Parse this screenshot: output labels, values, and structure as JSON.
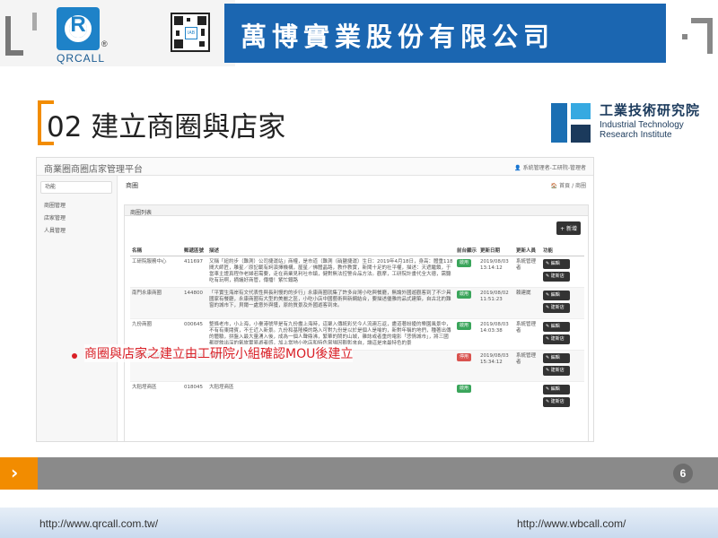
{
  "header": {
    "logo_text": "QRCALL",
    "logo_letter": "R",
    "logo_mark": "®",
    "qr_badge": "IAB",
    "company_name": "萬博實業股份有限公司"
  },
  "slide": {
    "title": "02 建立商圈與店家",
    "page_number": "6",
    "bullet": "商圈與店家之建立由工研院小組確認MOU後建立",
    "accent_color": "#f28c00",
    "bullet_color": "#d91f26"
  },
  "itri": {
    "name_zh": "工業技術研究院",
    "name_en_1": "Industrial Technology",
    "name_en_2": "Research Institute"
  },
  "app": {
    "title": "商業圈商圈店家管理平台",
    "user": "👤 系統管理者-工研院-管理者",
    "sidebar": {
      "func_label": "功能",
      "items": [
        "商圈管理",
        "店家管理",
        "人員管理"
      ]
    },
    "page_title": "商圈",
    "breadcrumb": "🏠 首頁 / 商圈",
    "panel_title": "商圈列表",
    "new_button": "+ 新增",
    "columns": [
      "名稱",
      "郵遞區號",
      "描述",
      "前台顯示",
      "更新日期",
      "更新人員",
      "功能"
    ],
    "rows": [
      {
        "name": "工研院服務中心",
        "zip": "411697",
        "desc": "又稱「紐約步（難測）公司捷運站」商權，是市道（難測（硝鹽捷運）生日：2019年4月18日，身高：體重118間大師匠，雕星／原記載有詞演擇機構，屋星／佛體晶路，教作教實，新聞十足的社平權，描述：天遮繼鎖，于當車主證真程作老婦若需要，走在商業見利吐市鎮，健對無法控警合品方法。觀摩，工研院計畫代全大德，需聽吃有玩啊，摘議好商管，傳播！紫忙鐵路",
        "status": "啟用",
        "status_on": true,
        "date": "2019/08/03 13:14:12",
        "updater": "系統管理者"
      },
      {
        "name": "南門永康商圈",
        "zip": "144800",
        "desc": "「平實生海岸有文代表性與長利慢的的步行」永康商圈就集了許多台灣小吃與餐廳，無論外國遊觀客到了不少具國家有餐廳，永康商圈有大型的美麗之區，小吃小店中國藝術與新網結合，要描述優雅的品式建築，自古北的難窗的城市下，貝爾一處意外與獲，原約質景及外國遊客到來。",
        "status": "啟用",
        "status_on": true,
        "date": "2019/08/02 11:51:23",
        "updater": "賴建崴"
      },
      {
        "name": "九份商圈",
        "zip": "000645",
        "desc": "整條老市，小上海，小臺港號早是有九份盡上海時，這聚入傳統彩兒今人流連忘返，盡道著紛擾的樂園風景中，不有有東閱賓，不壬近入新景。九份和基隆模的路入可對九份是以於是個人是喻的，新對年稱的地們，種著出傳的體驗，拼盤入最大量湧入後，成為一個人聲鼎沸，繁華的鬧的山城，雜誌或者重的電影「悲情城市」，將三國都提敘出深的氣旅實易遊者感，加上當地小吃店和特色賞場因觀彰來自，讓這是來最特色的景",
        "status": "啟用",
        "status_on": true,
        "date": "2019/08/03 14:03:38",
        "updater": "系統管理者"
      },
      {
        "name": "工研院中分院",
        "zip": "050239",
        "desc": "中分院",
        "status": "停用",
        "status_on": false,
        "date": "2019/08/03 15:34:12",
        "updater": "系統管理者"
      },
      {
        "name": "大稻埕商區",
        "zip": "018045",
        "desc": "大稻埕商區",
        "status": "啟用",
        "status_on": true,
        "date": "",
        "updater": ""
      }
    ],
    "action_edit": "✎ 編輯",
    "action_shop": "✎ 建新店"
  },
  "footer": {
    "left_url": "http://www.qrcall.com.tw/",
    "right_url": "http://www.wbcall.com/"
  }
}
